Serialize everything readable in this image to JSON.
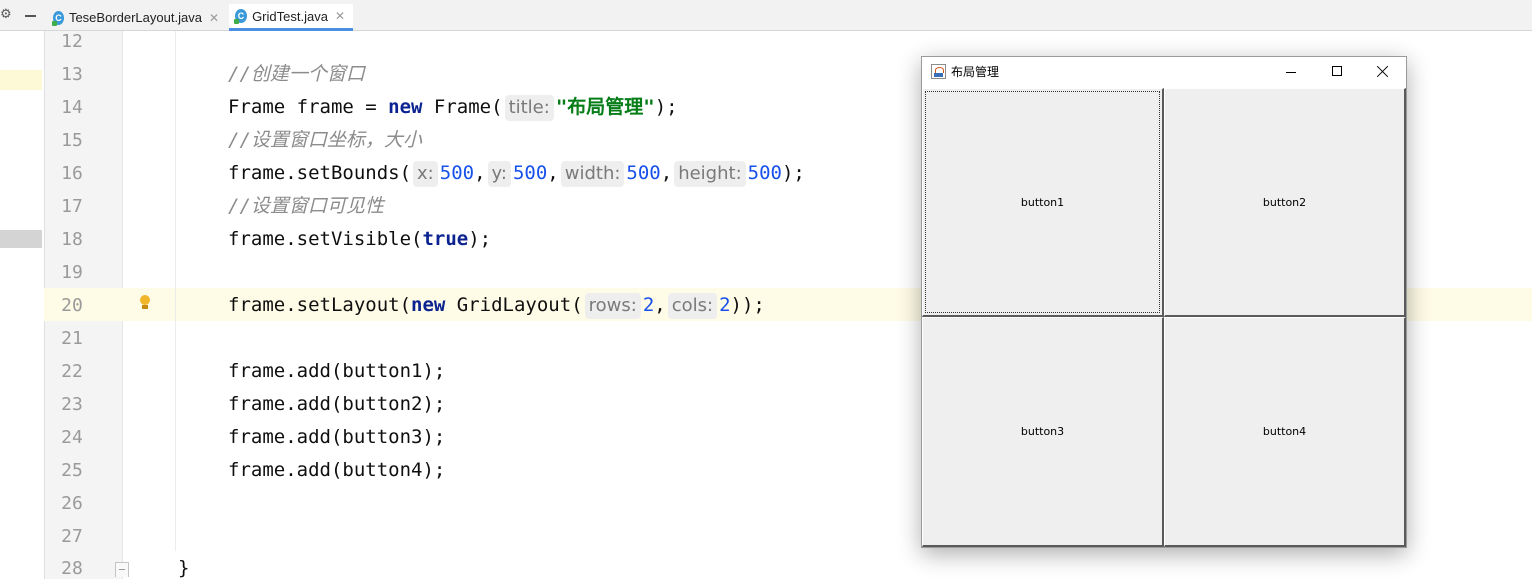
{
  "tabs": [
    {
      "label": "TeseBorderLayout.java",
      "icon": "java-class-icon",
      "active": false
    },
    {
      "label": "GridTest.java",
      "icon": "java-class-icon",
      "active": true
    }
  ],
  "editor": {
    "lines": [
      {
        "n": "12"
      },
      {
        "n": "13",
        "comment": "//创建一个窗口"
      },
      {
        "n": "14",
        "pre": "Frame frame = ",
        "kw": "new",
        "post": " Frame(",
        "hint": "title:",
        "str": "\"布局管理\"",
        "end": ");"
      },
      {
        "n": "15",
        "comment": "//设置窗口坐标，大小"
      },
      {
        "n": "16",
        "pre": "frame.setBounds(",
        "h1": "x:",
        "v1": "500",
        "h2": "y:",
        "v2": "500",
        "h3": "width:",
        "v3": "500",
        "h4": "height:",
        "v4": "500",
        "end": ");"
      },
      {
        "n": "17",
        "comment": "//设置窗口可见性"
      },
      {
        "n": "18",
        "pre": "frame.setVisible(",
        "kw": "true",
        "end": ");"
      },
      {
        "n": "19"
      },
      {
        "n": "20",
        "pre": "frame.setLayout(",
        "kw": "new",
        "mid": " GridLayout(",
        "h1": "rows:",
        "v1": "2",
        "h2": "cols:",
        "v2": "2",
        "end": "));"
      },
      {
        "n": "21"
      },
      {
        "n": "22",
        "text": "frame.add(button1);"
      },
      {
        "n": "23",
        "text": "frame.add(button2);"
      },
      {
        "n": "24",
        "text": "frame.add(button3);"
      },
      {
        "n": "25",
        "text": "frame.add(button4);"
      },
      {
        "n": "26"
      },
      {
        "n": "27"
      },
      {
        "n": "28",
        "text": "}"
      }
    ]
  },
  "java_window": {
    "title": "布局管理",
    "buttons": [
      "button1",
      "button2",
      "button3",
      "button4"
    ]
  },
  "colors": {
    "keyword": "#0b2291",
    "number": "#1750eb",
    "string": "#067d17",
    "comment": "#8c8c8c",
    "current_line": "#fefbe6",
    "active_tab_underline": "#4a8fe3"
  }
}
